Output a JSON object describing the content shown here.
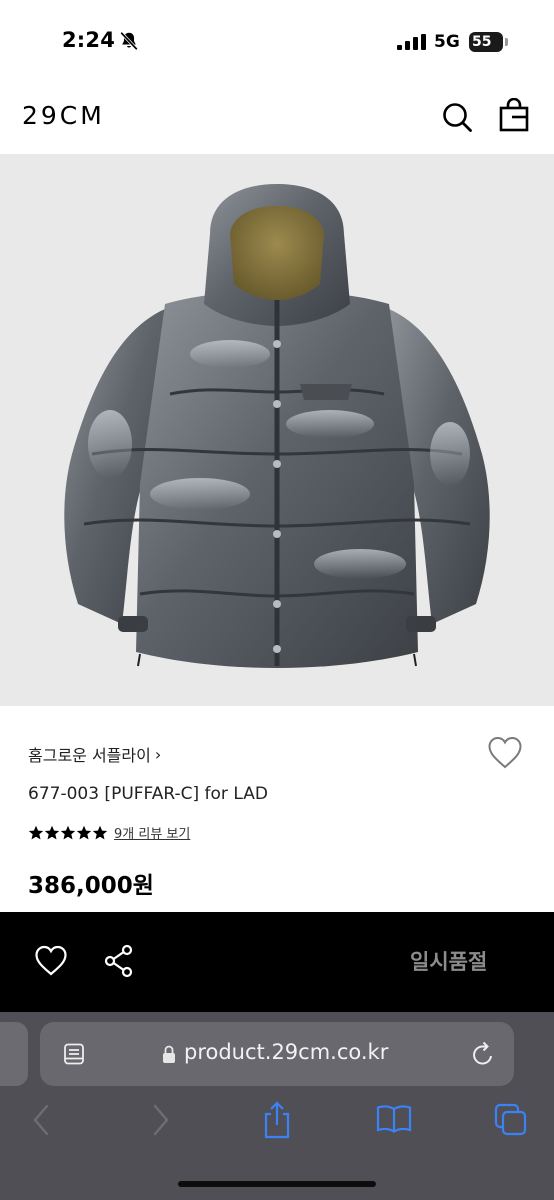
{
  "status_bar": {
    "time": "2:24",
    "network": "5G",
    "battery": "55",
    "icons": [
      "bell-slash-icon",
      "cellular-signal-icon",
      "battery-icon"
    ]
  },
  "header": {
    "logo": "29CM",
    "icons": [
      "search-icon",
      "shopping-bag-icon"
    ]
  },
  "product": {
    "image": "glossy-grey-hooded-puffer-jacket-photo",
    "brand": "홈그로운 서플라이",
    "brand_chevron": "›",
    "name": "677-003 [PUFFAR-C] for LAD",
    "rating_stars": 5,
    "review_link": "9개 리뷰 보기",
    "price": "386,000원"
  },
  "action_bar": {
    "soldout_label": "일시품절",
    "icons": [
      "heart-icon",
      "share-icon"
    ]
  },
  "browser": {
    "url": "product.29cm.co.kr",
    "icons": [
      "reader-icon",
      "lock-icon",
      "reload-icon",
      "back-icon",
      "forward-icon",
      "share-icon",
      "bookmarks-icon",
      "tabs-icon"
    ]
  },
  "colors": {
    "action_bar_bg": "#000000",
    "soldout_text": "#8c8c8c",
    "browser_bg": "#4f4f55",
    "browser_accent": "#3b82f6"
  }
}
